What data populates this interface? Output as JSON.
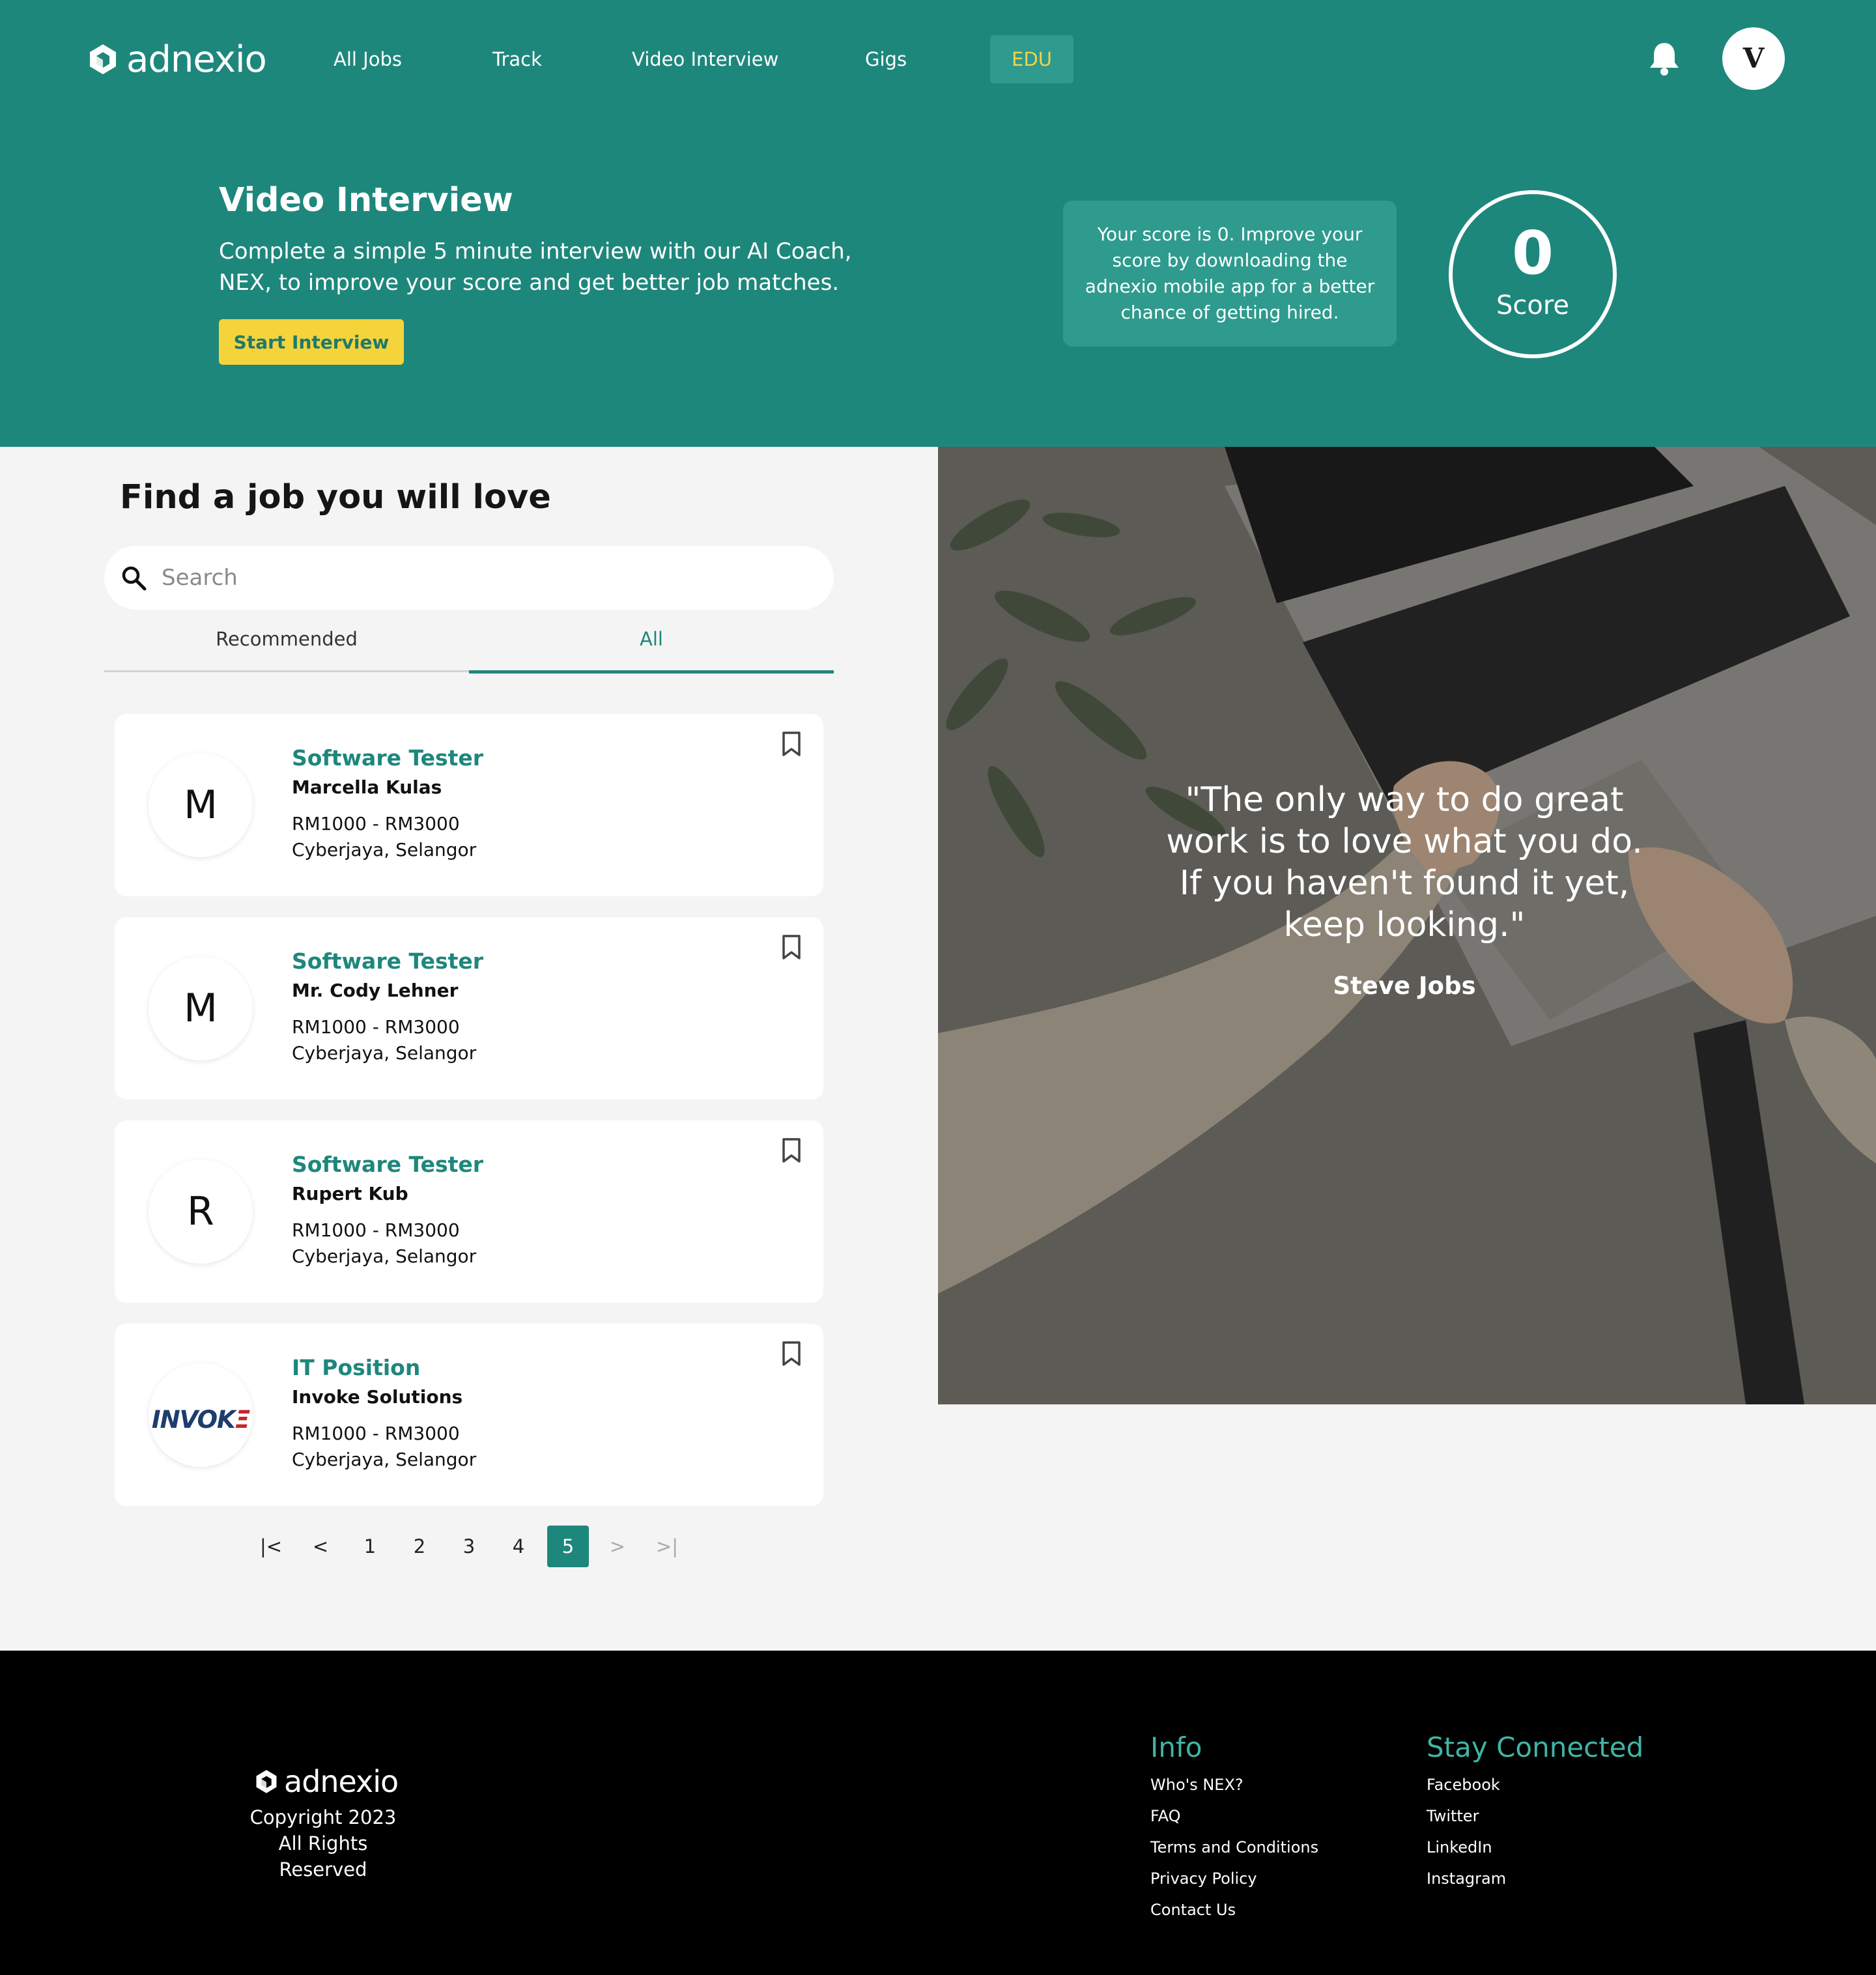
{
  "brand": {
    "name": "adnexio"
  },
  "nav": {
    "items": [
      "All Jobs",
      "Track",
      "Video Interview",
      "Gigs",
      "EDU"
    ],
    "user_initial": "V"
  },
  "hero": {
    "title": "Video Interview",
    "description": "Complete a simple 5 minute interview with our AI Coach, NEX, to improve your score and get better job matches.",
    "button": "Start Interview",
    "score_note": "Your score is 0. Improve your score by downloading the adnexio mobile app for a better chance of getting hired.",
    "score_value": "0",
    "score_label": "Score"
  },
  "finder": {
    "title": "Find a job you will love",
    "search_placeholder": "Search",
    "tabs": [
      "Recommended",
      "All"
    ],
    "active_tab": "All"
  },
  "jobs": [
    {
      "initial": "M",
      "title": "Software Tester",
      "company": "Marcella Kulas",
      "salary": "RM1000 - RM3000",
      "location": "Cyberjaya, Selangor"
    },
    {
      "initial": "M",
      "title": "Software Tester",
      "company": "Mr. Cody Lehner",
      "salary": "RM1000 - RM3000",
      "location": "Cyberjaya, Selangor"
    },
    {
      "initial": "R",
      "title": "Software Tester",
      "company": "Rupert Kub",
      "salary": "RM1000 - RM3000",
      "location": "Cyberjaya, Selangor"
    },
    {
      "logo_text": "INVOK",
      "logo_accent": "Ξ",
      "title": "IT Position",
      "company": "Invoke Solutions",
      "salary": "RM1000 - RM3000",
      "location": "Cyberjaya, Selangor"
    }
  ],
  "pagination": {
    "first": "|<",
    "prev": "<",
    "pages": [
      "1",
      "2",
      "3",
      "4",
      "5"
    ],
    "current": "5",
    "next": ">",
    "last": ">|"
  },
  "quote": {
    "text": "\"The only way to do great work is to love what you do. If you haven't found it yet, keep looking.\"",
    "author": "Steve Jobs"
  },
  "footer": {
    "brand": "adnexio",
    "copyright": "Copyright 2023",
    "rights": "All Rights Reserved",
    "info_title": "Info",
    "info_links": [
      "Who's NEX?",
      "FAQ",
      "Terms and Conditions",
      "Privacy Policy",
      "Contact Us"
    ],
    "connect_title": "Stay Connected",
    "connect_links": [
      "Facebook",
      "Twitter",
      "LinkedIn",
      "Instagram"
    ]
  },
  "colors": {
    "primary": "#1e877c",
    "accent": "#f5d33a",
    "footer_bg": "#000000",
    "footer_title": "#3fb5a6"
  },
  "icons": [
    "logo-mark-icon",
    "bell-icon",
    "search-icon",
    "bookmark-icon"
  ]
}
